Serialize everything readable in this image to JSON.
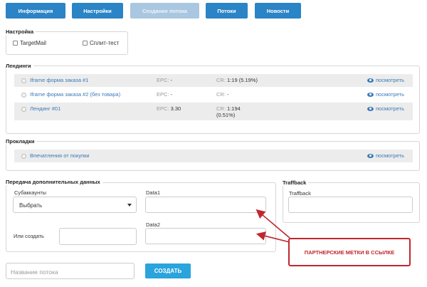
{
  "nav": {
    "items": [
      {
        "label": "Информация",
        "disabled": false
      },
      {
        "label": "Настройки",
        "disabled": false
      },
      {
        "label": "Создание потока",
        "disabled": true
      },
      {
        "label": "Потоки",
        "disabled": false
      },
      {
        "label": "Новости",
        "disabled": false
      }
    ]
  },
  "settings": {
    "legend": "Настройка",
    "targetmail_label": "TargetMail",
    "split_label": "Сплит-тест"
  },
  "landings": {
    "legend": "Лендинги",
    "epc_label": "EPC:",
    "cr_label": "CR:",
    "view_label": "посмотреть",
    "rows": [
      {
        "name": "Iframe форма заказа #1",
        "epc": "-",
        "cr": "1:19 (5.19%)",
        "cr2": ""
      },
      {
        "name": "Iframe форма заказа #2 (без товара)",
        "epc": "-",
        "cr": "-",
        "cr2": ""
      },
      {
        "name": "Лендинг #01",
        "epc": "3.30",
        "cr": "1:194",
        "cr2": "(0.51%)"
      }
    ]
  },
  "prelandings": {
    "legend": "Прокладки",
    "rows": [
      {
        "name": "Впечатления от покупки"
      }
    ]
  },
  "extra": {
    "legend": "Передача дополнительных данных",
    "subaccounts_label": "Субаккаунты",
    "subaccounts_value": "Выбрать",
    "or_create_label": "Или создать",
    "data1_label": "Data1",
    "data2_label": "Data2"
  },
  "traffback": {
    "legend": "Traffback",
    "field_label": "Traffback"
  },
  "footer": {
    "stream_name_placeholder": "Название потока",
    "create_label": "СОЗДАТЬ"
  },
  "annotation": {
    "text": "ПАРТНЕРСКИЕ МЕТКИ В ССЫЛКЕ",
    "color": "#c0262d"
  },
  "colors": {
    "primary": "#2a84c5",
    "create": "#2aa4dc",
    "link": "#3a79b7"
  },
  "icons": [
    "eye-icon",
    "chevron-down-icon",
    "checkbox",
    "radio"
  ]
}
